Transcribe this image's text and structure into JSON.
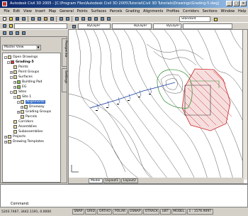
{
  "window": {
    "title": "Autodesk Civil 3D 2005 - [C:\\Program Files\\Autodesk Civil 3D 2005\\Tutorial\\Civil 3D Tutorials\\Drawings\\Grading-5.dwg]",
    "minimize": "_",
    "maximize": "□",
    "close": "×"
  },
  "menu": {
    "items": [
      "File",
      "Edit",
      "View",
      "Insert",
      "Map",
      "General",
      "Points",
      "Surfaces",
      "Parcels",
      "Grading",
      "Alignments",
      "Profiles",
      "Corridors",
      "Sections",
      "Window",
      "Help"
    ]
  },
  "toolbar": {
    "layer_combo": "ByLayer",
    "linetype_combo": "ByLayer",
    "lineweight_combo": "ByLayer",
    "style_combo": "Standard"
  },
  "prospector": {
    "view_combo": "Master View",
    "tabs": [
      "Prospector",
      "Settings"
    ],
    "tree": [
      {
        "label": "Open Drawings",
        "level": 0,
        "toggle": "-"
      },
      {
        "label": "Grading-5",
        "level": 1,
        "toggle": "-"
      },
      {
        "label": "Points",
        "level": 2,
        "toggle": ""
      },
      {
        "label": "Point Groups",
        "level": 2,
        "toggle": "+"
      },
      {
        "label": "Surfaces",
        "level": 2,
        "toggle": "-"
      },
      {
        "label": "Building Pad",
        "level": 3,
        "toggle": "+"
      },
      {
        "label": "EG",
        "level": 3,
        "toggle": "+"
      },
      {
        "label": "Sites",
        "level": 2,
        "toggle": "-"
      },
      {
        "label": "Site 1",
        "level": 3,
        "toggle": "-"
      },
      {
        "label": "Alignments",
        "level": 4,
        "toggle": "-",
        "selected": true
      },
      {
        "label": "Driveway",
        "level": 5,
        "toggle": "+"
      },
      {
        "label": "Grading Groups",
        "level": 4,
        "toggle": "+"
      },
      {
        "label": "Parcels",
        "level": 4,
        "toggle": ""
      },
      {
        "label": "Corridors",
        "level": 2,
        "toggle": ""
      },
      {
        "label": "Assemblies",
        "level": 2,
        "toggle": ""
      },
      {
        "label": "Subassemblies",
        "level": 2,
        "toggle": ""
      },
      {
        "label": "Projects",
        "level": 0,
        "toggle": "+"
      },
      {
        "label": "Drawing Templates",
        "level": 0,
        "toggle": "+"
      }
    ]
  },
  "layout_tabs": [
    "Model",
    "Layout1",
    "Layout2"
  ],
  "command": {
    "prompt": "Command:"
  },
  "status": {
    "coords": "5203.7467, 3442.1191, 0.0000",
    "toggles": [
      "SNAP",
      "GRID",
      "ORTHO",
      "POLAR",
      "OSNAP",
      "OTRACK",
      "LWT",
      "MODEL"
    ],
    "scale": "1 : 1576.9097"
  },
  "colors": {
    "title_bar": "#0a246a",
    "selection": "#316ac5",
    "hatch": "#cc2222",
    "parcel_line": "#2e8b2e"
  }
}
